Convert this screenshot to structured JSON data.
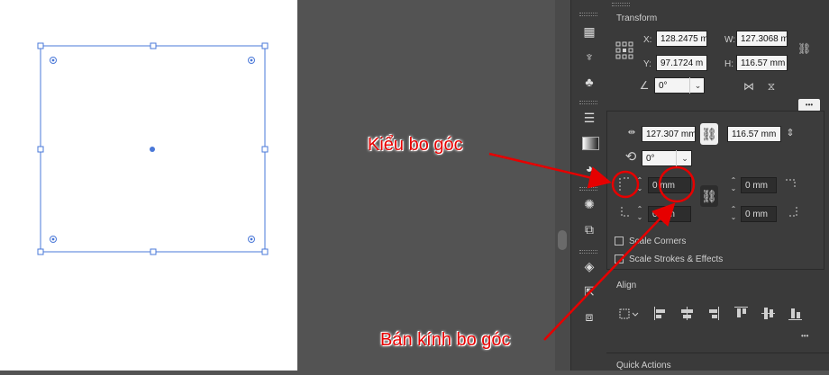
{
  "transform": {
    "header": "Transform",
    "x_label": "X:",
    "x_value": "128.2475 m",
    "y_label": "Y:",
    "y_value": "97.1724 m",
    "w_label": "W:",
    "w_value": "127.3068 m",
    "h_label": "H:",
    "h_value": "116.57 mm",
    "angle_value": "0°",
    "more_glyph": "•••"
  },
  "popup": {
    "width_value": "127.307 mm",
    "height_value": "116.57 mm",
    "rotate_value": "0°",
    "corner_tl_value": "0 mm",
    "corner_tr_value": "0 mm",
    "corner_bl_value": "0 mm",
    "corner_br_value": "0 mm",
    "scale_corners_label": "Scale Corners",
    "scale_strokes_label": "Scale Strokes & Effects"
  },
  "align": {
    "header": "Align",
    "more_glyph": "•••"
  },
  "quick_actions": {
    "header": "Quick Actions"
  },
  "annotations": {
    "corner_type": "Kiểu bo góc",
    "corner_radius": "Bán kính bo góc"
  },
  "colors": {
    "annotation": "#e60000",
    "selection": "#4a78d8"
  }
}
